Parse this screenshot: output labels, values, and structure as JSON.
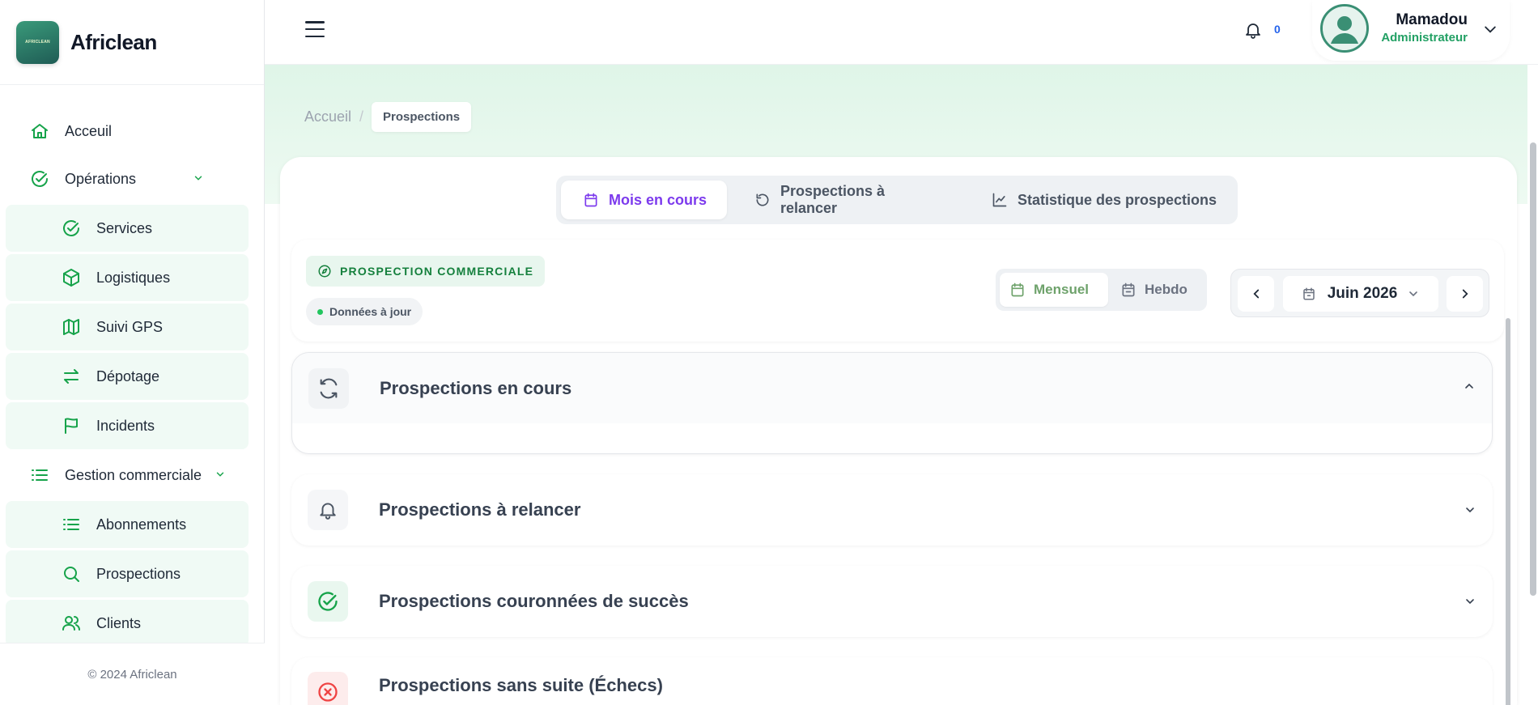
{
  "brand": {
    "name": "Africlean",
    "logo_text": "AFRICLEAN"
  },
  "sidebar": {
    "items": [
      {
        "label": "Acceuil",
        "icon": "home-icon",
        "level": "top"
      },
      {
        "label": "Opérations",
        "icon": "check-circle-icon",
        "level": "top",
        "expanded": true
      },
      {
        "label": "Services",
        "icon": "check-circle-icon",
        "level": "sub"
      },
      {
        "label": "Logistiques",
        "icon": "box-icon",
        "level": "sub"
      },
      {
        "label": "Suivi GPS",
        "icon": "map-icon",
        "level": "sub"
      },
      {
        "label": "Dépotage",
        "icon": "transfer-icon",
        "level": "sub"
      },
      {
        "label": "Incidents",
        "icon": "flag-icon",
        "level": "sub"
      },
      {
        "label": "Gestion commerciale",
        "icon": "list-icon",
        "level": "top",
        "expanded": true
      },
      {
        "label": "Abonnements",
        "icon": "list-icon",
        "level": "sub"
      },
      {
        "label": "Prospections",
        "icon": "search-icon",
        "level": "sub"
      },
      {
        "label": "Clients",
        "icon": "users-icon",
        "level": "sub"
      }
    ],
    "footer": "© 2024 Africlean"
  },
  "header": {
    "notification_count": "0",
    "user": {
      "name": "Mamadou",
      "role": "Administrateur"
    }
  },
  "breadcrumb": {
    "home": "Accueil",
    "separator": "/",
    "current": "Prospections"
  },
  "tabs": [
    {
      "label": "Mois en cours",
      "icon": "calendar-icon",
      "active": true
    },
    {
      "label": "Prospections à relancer",
      "icon": "rotate-icon",
      "active": false
    },
    {
      "label": "Statistique des prospections",
      "icon": "chart-line-icon",
      "active": false
    }
  ],
  "filters": {
    "badge": "PROSPECTION COMMERCIALE",
    "status": "Données à jour",
    "period": {
      "monthly": "Mensuel",
      "weekly": "Hebdo",
      "selected": "Mensuel"
    },
    "month": "Juin 2026"
  },
  "sections": [
    {
      "title": "Prospections en cours",
      "icon": "refresh-icon",
      "expanded": true
    },
    {
      "title": "Prospections à relancer",
      "icon": "bell-icon",
      "expanded": false
    },
    {
      "title": "Prospections couronnées de succès",
      "icon": "check-circle-icon",
      "expanded": false
    },
    {
      "title": "Prospections sans suite (Échecs)",
      "icon": "x-circle-icon",
      "expanded": false
    }
  ],
  "colors": {
    "accent_green": "#16a34a",
    "active_tab": "#7c3aed",
    "notification": "#2563eb",
    "danger": "#ef4444"
  }
}
